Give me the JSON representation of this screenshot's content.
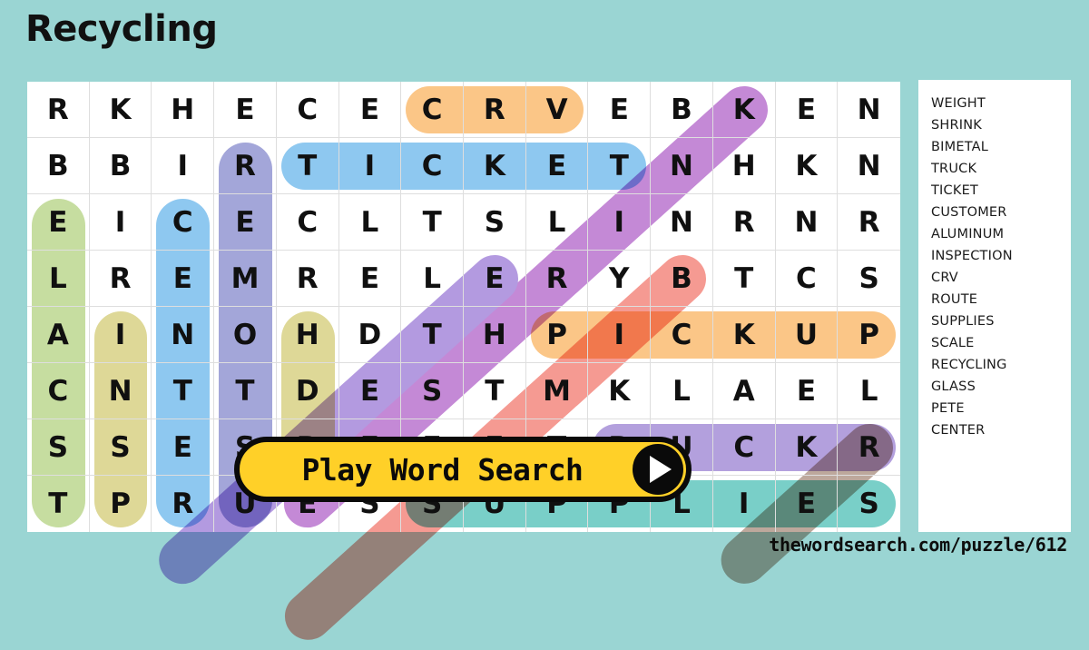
{
  "page": {
    "title": "Recycling",
    "background_color": "#9ad5d3",
    "footer_url": "thewordsearch.com/puzzle/612"
  },
  "play_button": {
    "label": "Play Word Search",
    "icon": "play-triangle-icon",
    "background_color": "#ffd028",
    "border_color": "#0a0a0a"
  },
  "grid": {
    "rows": 8,
    "cols": 14,
    "letters": [
      [
        "R",
        "K",
        "H",
        "E",
        "C",
        "E",
        "C",
        "R",
        "V",
        "E",
        "B",
        "K",
        "E",
        "N"
      ],
      [
        "B",
        "B",
        "I",
        "R",
        "T",
        "I",
        "C",
        "K",
        "E",
        "T",
        "N",
        "H",
        "K",
        "N"
      ],
      [
        "E",
        "I",
        "C",
        "E",
        "C",
        "L",
        "T",
        "S",
        "L",
        "I",
        "N",
        "R",
        "N",
        "R"
      ],
      [
        "L",
        "R",
        "E",
        "M",
        "R",
        "E",
        "L",
        "E",
        "R",
        "Y",
        "B",
        "T",
        "C",
        "S"
      ],
      [
        "A",
        "I",
        "N",
        "O",
        "H",
        "D",
        "T",
        "H",
        "P",
        "I",
        "C",
        "K",
        "U",
        "P"
      ],
      [
        "C",
        "N",
        "T",
        "T",
        "D",
        "E",
        "S",
        "T",
        "M",
        "K",
        "L",
        "A",
        "E",
        "L"
      ],
      [
        "S",
        "S",
        "E",
        "S",
        "R",
        "E",
        "E",
        "E",
        "T",
        "R",
        "U",
        "C",
        "K",
        "R"
      ],
      [
        "T",
        "P",
        "R",
        "U",
        "E",
        "S",
        "S",
        "U",
        "P",
        "P",
        "L",
        "I",
        "E",
        "S"
      ]
    ]
  },
  "word_list": [
    "WEIGHT",
    "SHRINK",
    "BIMETAL",
    "TRUCK",
    "TICKET",
    "CUSTOMER",
    "ALUMINUM",
    "INSPECTION",
    "CRV",
    "ROUTE",
    "SUPPLIES",
    "SCALE",
    "RECYCLING",
    "GLASS",
    "PETE",
    "CENTER"
  ],
  "highlights": {
    "straight": [
      {
        "name": "crv",
        "color": "#fbc687",
        "orientation": "horizontal",
        "row": 0,
        "col": 6,
        "length": 3
      },
      {
        "name": "ticket",
        "color": "#8ec8f0",
        "orientation": "horizontal",
        "row": 1,
        "col": 4,
        "length": 6
      },
      {
        "name": "pickup",
        "color": "#fbc687",
        "orientation": "horizontal",
        "row": 4,
        "col": 8,
        "length": 6
      },
      {
        "name": "truck",
        "color": "#b3a0dd",
        "orientation": "horizontal",
        "row": 6,
        "col": 9,
        "length": 5
      },
      {
        "name": "supplies",
        "color": "#79cfc8",
        "orientation": "horizontal",
        "row": 7,
        "col": 6,
        "length": 8
      },
      {
        "name": "scale",
        "color": "#c6dda0",
        "orientation": "vertical",
        "row": 2,
        "col": 0,
        "length": 6
      },
      {
        "name": "insp-col1",
        "color": "#ded897",
        "orientation": "vertical",
        "row": 4,
        "col": 1,
        "length": 4
      },
      {
        "name": "center",
        "color": "#8ec8f0",
        "orientation": "vertical",
        "row": 2,
        "col": 2,
        "length": 6
      },
      {
        "name": "pete",
        "color": "#a3a6d9",
        "orientation": "vertical",
        "row": 1,
        "col": 3,
        "length": 7
      },
      {
        "name": "shrink",
        "color": "#ded897",
        "orientation": "vertical",
        "row": 4,
        "col": 4,
        "length": 3
      }
    ],
    "diagonal": [
      {
        "name": "recycling",
        "color": "#c489d6",
        "row": 0,
        "col": 11,
        "length": 8,
        "dr": 1,
        "dc": -1
      },
      {
        "name": "customer",
        "color": "#b39ae0",
        "row": 3,
        "col": 7,
        "length": 6,
        "dr": 1,
        "dc": -1
      },
      {
        "name": "bimetal",
        "color": "#f59a92",
        "row": 3,
        "col": 10,
        "length": 7,
        "dr": 1,
        "dc": -1
      },
      {
        "name": "glass",
        "color": "#bda89c",
        "row": 6,
        "col": 13,
        "length": 3,
        "dr": 1,
        "dc": -1
      }
    ]
  }
}
